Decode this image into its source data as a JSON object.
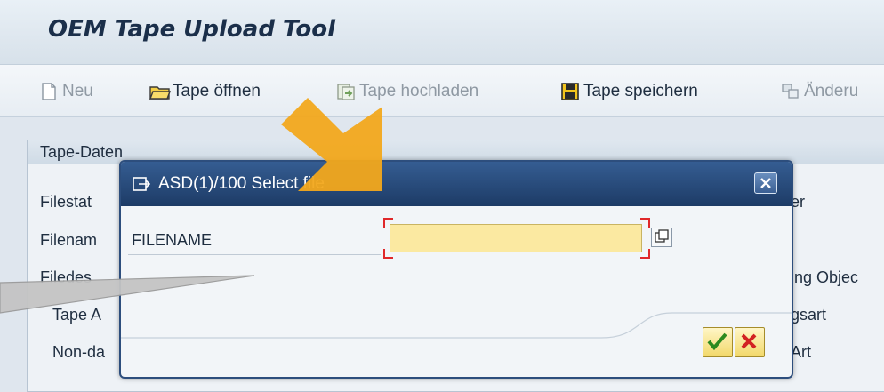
{
  "app": {
    "title": "OEM Tape Upload Tool"
  },
  "toolbar": {
    "items": [
      {
        "label": "Neu",
        "icon": "new-document-icon",
        "enabled": false
      },
      {
        "label": "Tape öffnen",
        "icon": "open-folder-icon",
        "enabled": true
      },
      {
        "label": "Tape hochladen",
        "icon": "upload-icon",
        "enabled": false
      },
      {
        "label": "Tape speichern",
        "icon": "save-disk-icon",
        "enabled": true
      },
      {
        "label": "Änderu",
        "icon": "changes-icon",
        "enabled": false
      }
    ]
  },
  "group": {
    "title": "Tape-Daten",
    "left_fields": [
      "Filestat",
      "Filenam",
      "Filedes",
      "Tape A",
      "Non-da"
    ],
    "right_fields": [
      "er",
      "ing Objec",
      "gsart",
      "Art"
    ]
  },
  "dialog": {
    "title": "ASD(1)/100 Select file",
    "field_label": "FILENAME",
    "filename_value": "",
    "colors": {
      "titlebar": "#254677",
      "input_bg": "#fbe9a1"
    }
  },
  "overlay": {
    "arrow_color": "#f2a81c"
  }
}
